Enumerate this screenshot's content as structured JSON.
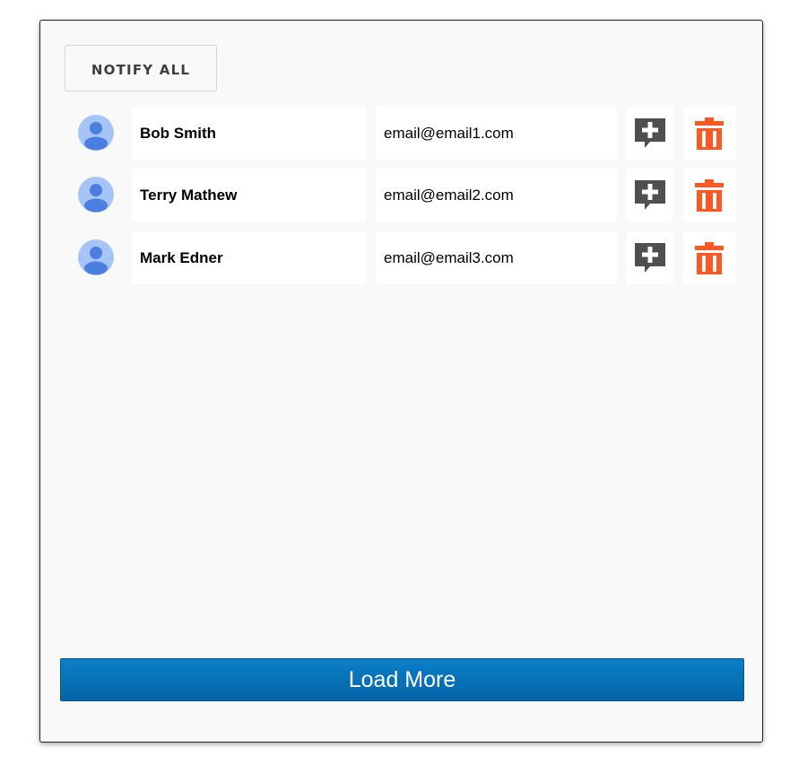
{
  "toolbar": {
    "notify_all_label": "NOTIFY ALL"
  },
  "contacts": [
    {
      "name": "Bob Smith",
      "email": "email@email1.com"
    },
    {
      "name": "Terry Mathew",
      "email": "email@email2.com"
    },
    {
      "name": "Mark Edner",
      "email": "email@email3.com"
    }
  ],
  "icons": {
    "avatar": "user-avatar-icon",
    "add_comment": "comment-add-icon",
    "delete": "trash-icon"
  },
  "colors": {
    "avatar_bg": "#a6c4f6",
    "avatar_fg": "#4a7fe0",
    "add_icon": "#4f4f4f",
    "delete_icon": "#ff5722",
    "load_more_bg": "#0872b8"
  },
  "footer": {
    "load_more_label": "Load More"
  }
}
